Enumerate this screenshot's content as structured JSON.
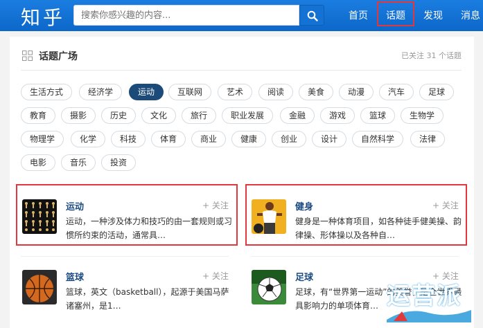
{
  "header": {
    "logo": "知乎",
    "search_placeholder": "搜索你感兴趣的内容...",
    "nav": [
      "首页",
      "话题",
      "发现",
      "消息"
    ]
  },
  "plaza": {
    "title": "话题广场",
    "followed_count": "已关注 31 个话题",
    "tags": [
      "生活方式",
      "经济学",
      "运动",
      "互联网",
      "艺术",
      "阅读",
      "美食",
      "动漫",
      "汽车",
      "足球",
      "教育",
      "摄影",
      "历史",
      "文化",
      "旅行",
      "职业发展",
      "金融",
      "游戏",
      "篮球",
      "生物学",
      "物理学",
      "化学",
      "科技",
      "体育",
      "商业",
      "健康",
      "创业",
      "设计",
      "自然科学",
      "法律",
      "电影",
      "音乐",
      "投资"
    ],
    "active_tag": "运动"
  },
  "cards": [
    {
      "name": "运动",
      "follow": "+ 关注",
      "desc": "运动，一种涉及体力和技巧的由一套规则或习惯所约束的活动，通常具…",
      "icon": "exercise-figures-icon"
    },
    {
      "name": "健身",
      "follow": "+ 关注",
      "desc": "健身是一种体育项目，如各种徒手健美操、韵律操、形体操以及各种自…",
      "icon": "fitness-man-icon"
    },
    {
      "name": "篮球",
      "follow": "+ 关注",
      "desc": "篮球，英文（basketball），起源于美国马萨诸塞州，是1…",
      "icon": "basketball-icon"
    },
    {
      "name": "足球",
      "follow": "+ 关注",
      "desc": "足球，有“世界第一运动”的美誉，是全世界最具影响力的单项体育…",
      "icon": "soccer-ball-icon"
    }
  ],
  "watermark": {
    "text": "运营派"
  },
  "colors": {
    "header": "#0c67c9",
    "accent_red": "#e0383c",
    "active_tag": "#1d4b79",
    "link": "#1a4a80"
  }
}
